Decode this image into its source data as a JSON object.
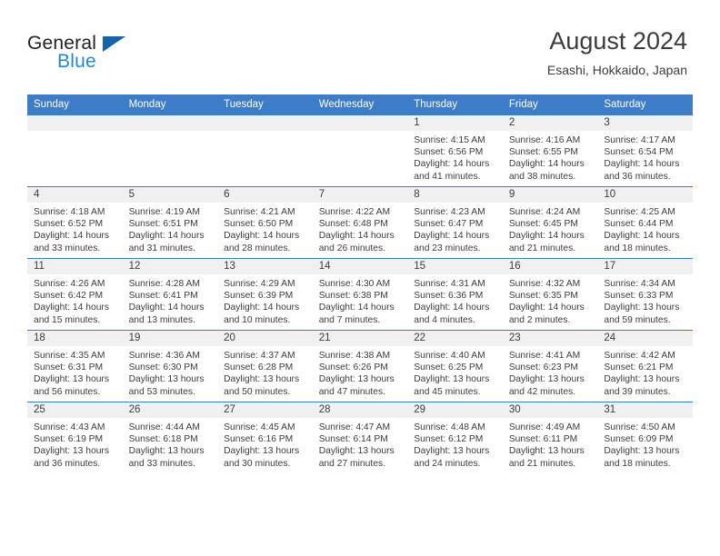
{
  "brand": {
    "name_top": "General",
    "name_bottom": "Blue",
    "color_dark": "#231f20",
    "color_blue": "#2387d4",
    "triangle_color": "#1563a8"
  },
  "header": {
    "title": "August 2024",
    "subtitle": "Esashi, Hokkaido, Japan"
  },
  "theme": {
    "header_blue": "#3d7cc9",
    "daynum_band": "#f0f0f0",
    "text": "#3c3c3c"
  },
  "weekdays": [
    "Sunday",
    "Monday",
    "Tuesday",
    "Wednesday",
    "Thursday",
    "Friday",
    "Saturday"
  ],
  "weeks": [
    [
      {
        "day": ""
      },
      {
        "day": ""
      },
      {
        "day": ""
      },
      {
        "day": ""
      },
      {
        "day": "1",
        "sunrise": "Sunrise: 4:15 AM",
        "sunset": "Sunset: 6:56 PM",
        "daylight": "Daylight: 14 hours and 41 minutes."
      },
      {
        "day": "2",
        "sunrise": "Sunrise: 4:16 AM",
        "sunset": "Sunset: 6:55 PM",
        "daylight": "Daylight: 14 hours and 38 minutes."
      },
      {
        "day": "3",
        "sunrise": "Sunrise: 4:17 AM",
        "sunset": "Sunset: 6:54 PM",
        "daylight": "Daylight: 14 hours and 36 minutes."
      }
    ],
    [
      {
        "day": "4",
        "sunrise": "Sunrise: 4:18 AM",
        "sunset": "Sunset: 6:52 PM",
        "daylight": "Daylight: 14 hours and 33 minutes."
      },
      {
        "day": "5",
        "sunrise": "Sunrise: 4:19 AM",
        "sunset": "Sunset: 6:51 PM",
        "daylight": "Daylight: 14 hours and 31 minutes."
      },
      {
        "day": "6",
        "sunrise": "Sunrise: 4:21 AM",
        "sunset": "Sunset: 6:50 PM",
        "daylight": "Daylight: 14 hours and 28 minutes."
      },
      {
        "day": "7",
        "sunrise": "Sunrise: 4:22 AM",
        "sunset": "Sunset: 6:48 PM",
        "daylight": "Daylight: 14 hours and 26 minutes."
      },
      {
        "day": "8",
        "sunrise": "Sunrise: 4:23 AM",
        "sunset": "Sunset: 6:47 PM",
        "daylight": "Daylight: 14 hours and 23 minutes."
      },
      {
        "day": "9",
        "sunrise": "Sunrise: 4:24 AM",
        "sunset": "Sunset: 6:45 PM",
        "daylight": "Daylight: 14 hours and 21 minutes."
      },
      {
        "day": "10",
        "sunrise": "Sunrise: 4:25 AM",
        "sunset": "Sunset: 6:44 PM",
        "daylight": "Daylight: 14 hours and 18 minutes."
      }
    ],
    [
      {
        "day": "11",
        "sunrise": "Sunrise: 4:26 AM",
        "sunset": "Sunset: 6:42 PM",
        "daylight": "Daylight: 14 hours and 15 minutes."
      },
      {
        "day": "12",
        "sunrise": "Sunrise: 4:28 AM",
        "sunset": "Sunset: 6:41 PM",
        "daylight": "Daylight: 14 hours and 13 minutes."
      },
      {
        "day": "13",
        "sunrise": "Sunrise: 4:29 AM",
        "sunset": "Sunset: 6:39 PM",
        "daylight": "Daylight: 14 hours and 10 minutes."
      },
      {
        "day": "14",
        "sunrise": "Sunrise: 4:30 AM",
        "sunset": "Sunset: 6:38 PM",
        "daylight": "Daylight: 14 hours and 7 minutes."
      },
      {
        "day": "15",
        "sunrise": "Sunrise: 4:31 AM",
        "sunset": "Sunset: 6:36 PM",
        "daylight": "Daylight: 14 hours and 4 minutes."
      },
      {
        "day": "16",
        "sunrise": "Sunrise: 4:32 AM",
        "sunset": "Sunset: 6:35 PM",
        "daylight": "Daylight: 14 hours and 2 minutes."
      },
      {
        "day": "17",
        "sunrise": "Sunrise: 4:34 AM",
        "sunset": "Sunset: 6:33 PM",
        "daylight": "Daylight: 13 hours and 59 minutes."
      }
    ],
    [
      {
        "day": "18",
        "sunrise": "Sunrise: 4:35 AM",
        "sunset": "Sunset: 6:31 PM",
        "daylight": "Daylight: 13 hours and 56 minutes."
      },
      {
        "day": "19",
        "sunrise": "Sunrise: 4:36 AM",
        "sunset": "Sunset: 6:30 PM",
        "daylight": "Daylight: 13 hours and 53 minutes."
      },
      {
        "day": "20",
        "sunrise": "Sunrise: 4:37 AM",
        "sunset": "Sunset: 6:28 PM",
        "daylight": "Daylight: 13 hours and 50 minutes."
      },
      {
        "day": "21",
        "sunrise": "Sunrise: 4:38 AM",
        "sunset": "Sunset: 6:26 PM",
        "daylight": "Daylight: 13 hours and 47 minutes."
      },
      {
        "day": "22",
        "sunrise": "Sunrise: 4:40 AM",
        "sunset": "Sunset: 6:25 PM",
        "daylight": "Daylight: 13 hours and 45 minutes."
      },
      {
        "day": "23",
        "sunrise": "Sunrise: 4:41 AM",
        "sunset": "Sunset: 6:23 PM",
        "daylight": "Daylight: 13 hours and 42 minutes."
      },
      {
        "day": "24",
        "sunrise": "Sunrise: 4:42 AM",
        "sunset": "Sunset: 6:21 PM",
        "daylight": "Daylight: 13 hours and 39 minutes."
      }
    ],
    [
      {
        "day": "25",
        "sunrise": "Sunrise: 4:43 AM",
        "sunset": "Sunset: 6:19 PM",
        "daylight": "Daylight: 13 hours and 36 minutes."
      },
      {
        "day": "26",
        "sunrise": "Sunrise: 4:44 AM",
        "sunset": "Sunset: 6:18 PM",
        "daylight": "Daylight: 13 hours and 33 minutes."
      },
      {
        "day": "27",
        "sunrise": "Sunrise: 4:45 AM",
        "sunset": "Sunset: 6:16 PM",
        "daylight": "Daylight: 13 hours and 30 minutes."
      },
      {
        "day": "28",
        "sunrise": "Sunrise: 4:47 AM",
        "sunset": "Sunset: 6:14 PM",
        "daylight": "Daylight: 13 hours and 27 minutes."
      },
      {
        "day": "29",
        "sunrise": "Sunrise: 4:48 AM",
        "sunset": "Sunset: 6:12 PM",
        "daylight": "Daylight: 13 hours and 24 minutes."
      },
      {
        "day": "30",
        "sunrise": "Sunrise: 4:49 AM",
        "sunset": "Sunset: 6:11 PM",
        "daylight": "Daylight: 13 hours and 21 minutes."
      },
      {
        "day": "31",
        "sunrise": "Sunrise: 4:50 AM",
        "sunset": "Sunset: 6:09 PM",
        "daylight": "Daylight: 13 hours and 18 minutes."
      }
    ]
  ]
}
